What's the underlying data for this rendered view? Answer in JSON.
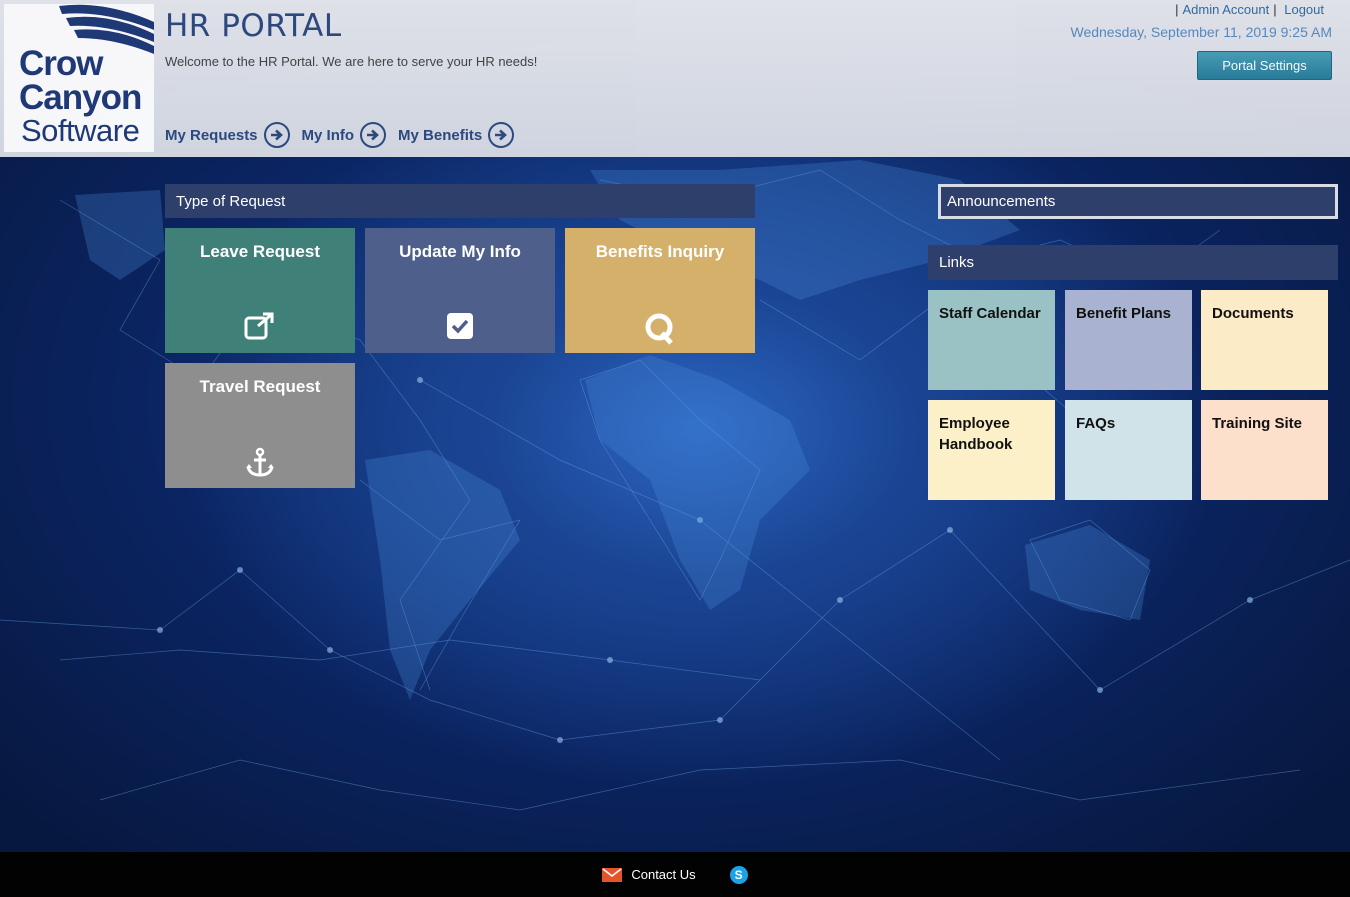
{
  "header": {
    "logo": {
      "line1": "Crow",
      "line2": "Canyon",
      "line3": "Software"
    },
    "title": "HR PORTAL",
    "welcome": "Welcome to the HR Portal. We are here to serve your HR needs!",
    "nav": [
      {
        "label": "My Requests"
      },
      {
        "label": "My Info"
      },
      {
        "label": "My Benefits"
      }
    ],
    "admin_link": "Admin Account",
    "logout_link": "Logout",
    "datetime": "Wednesday, September 11, 2019 9:25 AM",
    "settings_button": "Portal Settings"
  },
  "requests": {
    "header": "Type of Request",
    "tiles": [
      {
        "label": "Leave Request",
        "icon": "external-link-icon",
        "color": "#3f8078"
      },
      {
        "label": "Update My Info",
        "icon": "checkbox-icon",
        "color": "#4e5f8c"
      },
      {
        "label": "Benefits Inquiry",
        "icon": "q-icon",
        "color": "#d4b06a"
      },
      {
        "label": "Travel Request",
        "icon": "anchor-icon",
        "color": "#8e8e8e"
      }
    ]
  },
  "announcements": {
    "header": "Announcements"
  },
  "links": {
    "header": "Links",
    "tiles": [
      {
        "label": "Staff Calendar",
        "color": "#9ac2c4"
      },
      {
        "label": "Benefit Plans",
        "color": "#a9b2d0"
      },
      {
        "label": "Documents",
        "color": "#fbebc6"
      },
      {
        "label": "Employee Handbook",
        "color": "#fcf0c8"
      },
      {
        "label": "FAQs",
        "color": "#d0e3e8"
      },
      {
        "label": "Training Site",
        "color": "#fde0cc"
      }
    ]
  },
  "footer": {
    "contact_label": "Contact Us",
    "skype_icon": "skype-icon",
    "mail_icon": "mail-icon"
  },
  "colors": {
    "header_bar": "#2e3f6b",
    "accent_text": "#2e4b80",
    "background": "#0b2050"
  }
}
